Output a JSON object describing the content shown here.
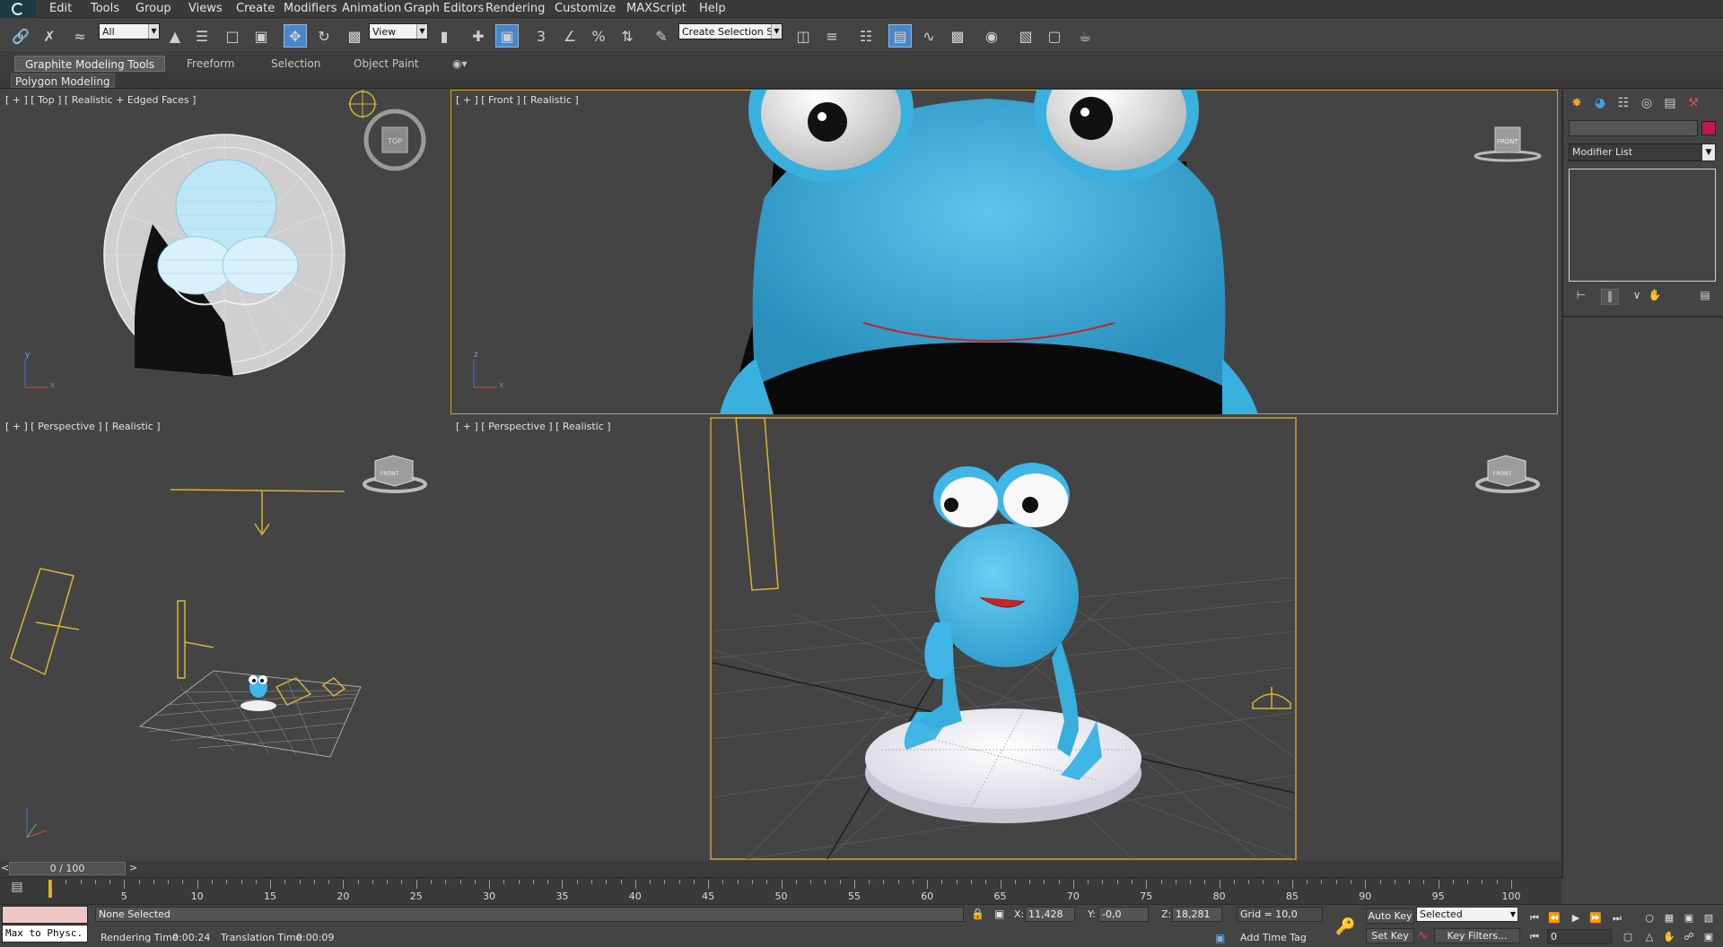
{
  "menu": [
    "Edit",
    "Tools",
    "Group",
    "Views",
    "Create",
    "Modifiers",
    "Animation",
    "Graph Editors",
    "Rendering",
    "Customize",
    "MAXScript",
    "Help"
  ],
  "toolbar": {
    "selection_filter": "All",
    "reference_coord": "View",
    "selection_set": "Create Selection Se",
    "snap_label": "3"
  },
  "ribbon": {
    "tabs": [
      "Graphite Modeling Tools",
      "Freeform",
      "Selection",
      "Object Paint"
    ],
    "panel_label": "Polygon Modeling"
  },
  "viewports": {
    "top_left": {
      "label": "[ + ] [ Top ] [ Realistic + Edged Faces ]",
      "viewcube": "TOP"
    },
    "top_right": {
      "label": "[ + ] [ Front ] [ Realistic ]",
      "viewcube": "FRONT"
    },
    "bottom_left": {
      "label": "[ + ] [ Perspective ] [ Realistic ]",
      "viewcube": "FRONT"
    },
    "bottom_right": {
      "label": "[ + ] [ Perspective ] [ Realistic ]",
      "viewcube": "FRONT"
    }
  },
  "command_panel": {
    "modifier_list": "Modifier List",
    "object_color": "#c4174a"
  },
  "timeline": {
    "frame_display": "0 / 100",
    "tick_labels": [
      "5",
      "10",
      "15",
      "20",
      "25",
      "30",
      "35",
      "40",
      "45",
      "50",
      "55",
      "60",
      "65",
      "70",
      "75",
      "80",
      "85",
      "90",
      "95",
      "100"
    ]
  },
  "status": {
    "maxscript_listener": "Max to Physc.",
    "selection": "None Selected",
    "rendering_time_label": "Rendering Time",
    "rendering_time": "0:00:24",
    "translation_time_label": "Translation Time",
    "translation_time": "0:00:09",
    "x_label": "X:",
    "x_value": "11,428",
    "y_label": "Y:",
    "y_value": "-0,0",
    "z_label": "Z:",
    "z_value": "18,281",
    "grid": "Grid = 10,0",
    "add_time_tag": "Add Time Tag",
    "auto_key": "Auto Key",
    "set_key": "Set Key",
    "key_mode": "Selected",
    "key_filters": "Key Filters...",
    "current_frame": "0"
  },
  "colors": {
    "accent_yellow": "#c8a23c",
    "active_blue": "#4a86c8",
    "frog_blue": "#3fb6e6"
  }
}
